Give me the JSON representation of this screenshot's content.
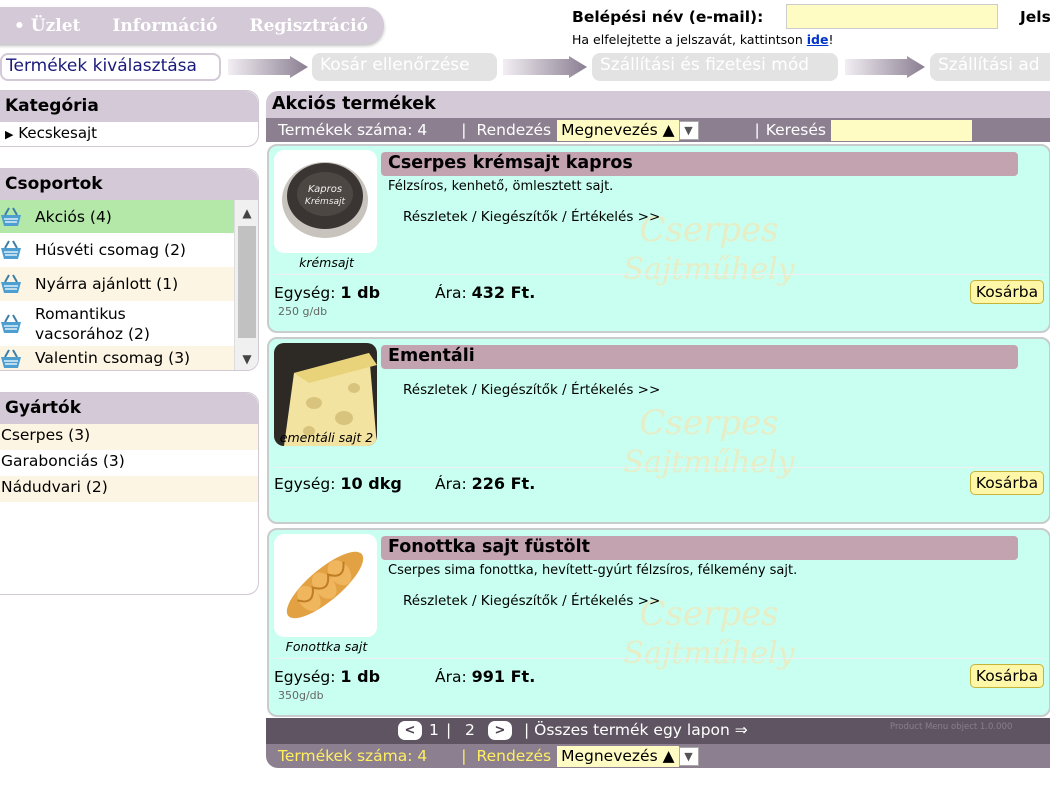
{
  "nav": {
    "items": [
      "• Üzlet",
      "Információ",
      "Regisztráció"
    ]
  },
  "login": {
    "label": "Belépési név (e-mail):",
    "label2": "Jels",
    "forgot_text": "Ha elfelejtette a jelszavát, kattintson ",
    "forgot_link": "ide",
    "forgot_end": "!"
  },
  "steps": [
    "Termékek kiválasztása",
    "Kosár ellenőrzése",
    "Szállítási és fizetési mód",
    "Szállítási ad"
  ],
  "sidebar": {
    "category_title": "Kategória",
    "category_item": "Kecskesajt",
    "groups_title": "Csoportok",
    "groups": [
      "Akciós (4)",
      "Húsvéti csomag (2)",
      "Nyárra ajánlott (1)",
      "Romantikus vacsorához (2)",
      "Valentin csomag (3)"
    ],
    "makers_title": "Gyártók",
    "makers": [
      "Cserpes (3)",
      "Garabonciás (3)",
      "Nádudvari (2)"
    ]
  },
  "main": {
    "title": "Akciós termékek",
    "count_label": "Termékek száma: 4",
    "sort_label": "Rendezés",
    "sort_value": "Megnevezés ▲",
    "search_label": "Keresés"
  },
  "products": [
    {
      "title": "Cserpes krémsajt kapros",
      "desc": "Félzsíros, kenhető, ömlesztett sajt.",
      "details": "Részletek / Kiegészítők / Értékelés >>",
      "caption": "krémsajt",
      "unit_label": "Egység:",
      "unit": "1 db",
      "price_label": "Ára:",
      "price": "432 Ft.",
      "weight": "250 g/db",
      "buy": "Kosárba"
    },
    {
      "title": "Ementáli",
      "desc": "",
      "details": "Részletek / Kiegészítők / Értékelés >>",
      "caption": "ementáli sajt 2",
      "unit_label": "Egység:",
      "unit": "10 dkg",
      "price_label": "Ára:",
      "price": "226 Ft.",
      "weight": "",
      "buy": "Kosárba"
    },
    {
      "title": "Fonottka sajt füstölt",
      "desc": "Cserpes sima fonottka, hevített-gyúrt félzsíros, félkemény sajt.",
      "details": "Részletek / Kiegészítők / Értékelés >>",
      "caption": "Fonottka sajt",
      "unit_label": "Egység:",
      "unit": "1 db",
      "price_label": "Ára:",
      "price": "991 Ft.",
      "weight": "350g/db",
      "buy": "Kosárba"
    }
  ],
  "pager": {
    "prev": "<",
    "page1": "1",
    "sep": "|",
    "page2": "2",
    "next": ">",
    "all": "| Összes termék egy lapon ⇒",
    "version": "Product Menu object 1.0.000"
  },
  "watermark": {
    "line1": "Cserpes",
    "line2": "Sajtműhely"
  },
  "colors": {
    "accent": "#d4c9d6",
    "card": "#c8fff0",
    "title_bar": "#c4a3b0",
    "highlight": "#b4e8a8"
  }
}
